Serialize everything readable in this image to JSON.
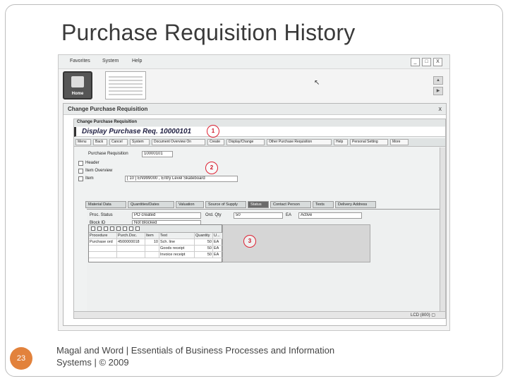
{
  "slide": {
    "title": "Purchase Requisition History",
    "number": "23",
    "footer": "Magal and Word | Essentials of Business Processes and Information Systems | © 2009"
  },
  "colors": {
    "accent": "#e2823c",
    "callout": "#d22233"
  },
  "window": {
    "menu": [
      "Favorites",
      "System",
      "Help"
    ],
    "controls": [
      "_",
      "□",
      "X"
    ],
    "home_label": "Home",
    "side_arrows": [
      "▲",
      "▶"
    ]
  },
  "dialog": {
    "title": "Change Purchase Requisition",
    "close": "x",
    "inner_title": "Change Purchase Requisition",
    "display_title": "Display Purchase Req. 10000101",
    "toolbar": [
      "Menu",
      "Back",
      "Cancel",
      "System",
      "Document Overview On",
      "Create",
      "Display/Change",
      "Other Purchase Requisition",
      "Help",
      "Personal Setting",
      "More"
    ],
    "doc_label": "Purchase Requisition",
    "doc_value": "10000101",
    "tree": [
      "Header",
      "Item Overview",
      "Item"
    ],
    "item_value": "[ 10 ] EN999000 , Entry Level Skateboard",
    "tabs": [
      "Material Data",
      "Quantities/Dates",
      "Valuation",
      "Source of Supply",
      "Status",
      "Contact Person",
      "Texts",
      "Delivery Address"
    ],
    "active_tab": "Status",
    "fields": {
      "proc_state_label": "Proc. Status",
      "proc_state_value": "PO created",
      "block_label": "Block ID",
      "block_value": "Not Blocked",
      "ord_qty_label": "Ord. Qty",
      "ord_qty_value": "50",
      "unit": "EA",
      "active_value": "Active"
    },
    "history": {
      "columns": [
        "Procedure",
        "Purch.Doc.",
        "Item",
        "Text",
        "Quantity",
        "U..."
      ],
      "rows": [
        [
          "Purchase ord",
          "4500000018",
          "10",
          "Sch. line",
          "50",
          "EA"
        ],
        [
          "",
          "",
          "",
          "Goods receipt",
          "50",
          "EA"
        ],
        [
          "",
          "",
          "",
          "Invoice receipt",
          "50",
          "EA"
        ]
      ]
    },
    "callouts": [
      "1",
      "2",
      "3"
    ],
    "status_bar": "LCD (800) ▢"
  }
}
